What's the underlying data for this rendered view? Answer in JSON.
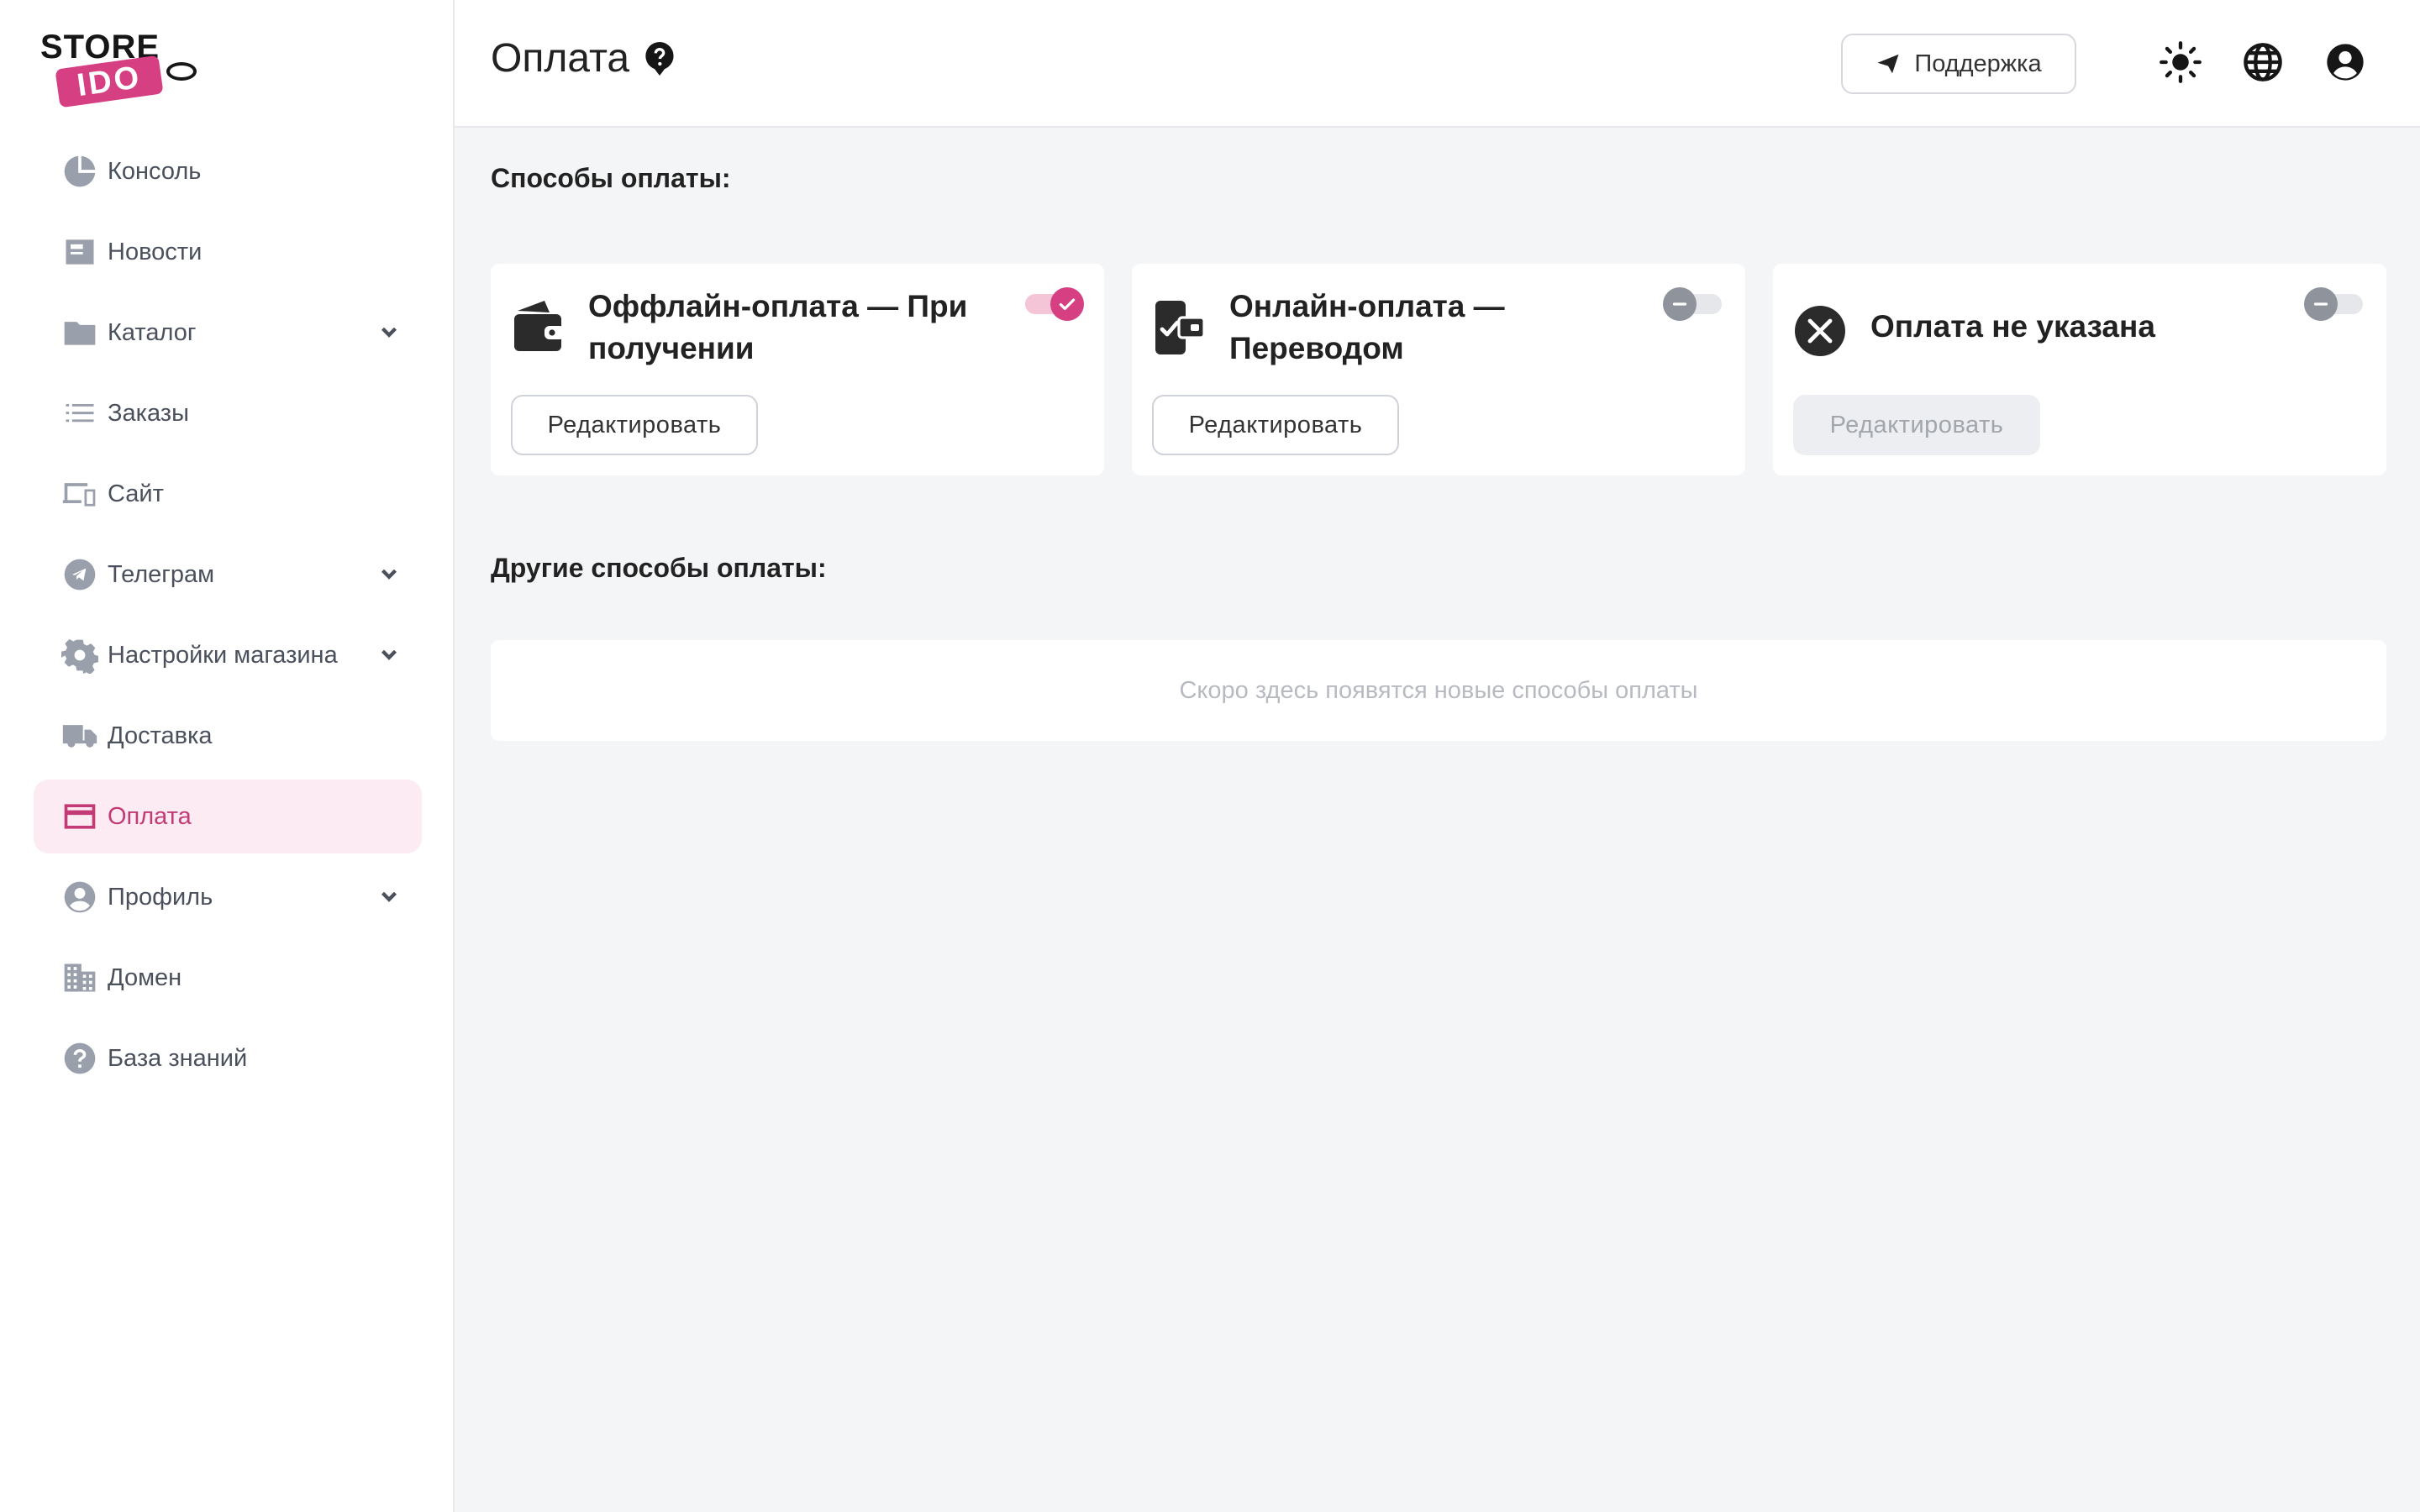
{
  "logo": {
    "line1": "STORE",
    "line2": "IDO"
  },
  "sidebar": {
    "items": [
      {
        "label": "Консоль",
        "icon": "pie-chart-icon",
        "active": false,
        "expandable": false
      },
      {
        "label": "Новости",
        "icon": "newspaper-icon",
        "active": false,
        "expandable": false
      },
      {
        "label": "Каталог",
        "icon": "folder-icon",
        "active": false,
        "expandable": true
      },
      {
        "label": "Заказы",
        "icon": "list-icon",
        "active": false,
        "expandable": false
      },
      {
        "label": "Сайт",
        "icon": "devices-icon",
        "active": false,
        "expandable": false
      },
      {
        "label": "Телеграм",
        "icon": "telegram-icon",
        "active": false,
        "expandable": true
      },
      {
        "label": "Настройки магазина",
        "icon": "gear-icon",
        "active": false,
        "expandable": true
      },
      {
        "label": "Доставка",
        "icon": "truck-icon",
        "active": false,
        "expandable": false
      },
      {
        "label": "Оплата",
        "icon": "credit-card-icon",
        "active": true,
        "expandable": false
      },
      {
        "label": "Профиль",
        "icon": "user-circle-icon",
        "active": false,
        "expandable": true
      },
      {
        "label": "Домен",
        "icon": "building-icon",
        "active": false,
        "expandable": false
      },
      {
        "label": "База знаний",
        "icon": "question-circle-icon",
        "active": false,
        "expandable": false
      }
    ]
  },
  "header": {
    "title": "Оплата",
    "support_label": "Поддержка",
    "icons": [
      "help-icon",
      "sun-icon",
      "globe-icon",
      "account-icon"
    ]
  },
  "main": {
    "methods_title": "Способы оплаты:",
    "cards": [
      {
        "title": "Оффлайн-оплата — При получении",
        "icon": "wallet-icon",
        "enabled": true,
        "edit_label": "Редактировать",
        "edit_disabled": false
      },
      {
        "title": "Онлайн-оплата — Переводом",
        "icon": "phone-wallet-icon",
        "enabled": false,
        "edit_label": "Редактировать",
        "edit_disabled": false
      },
      {
        "title": "Оплата не указана",
        "icon": "x-circle-icon",
        "enabled": false,
        "edit_label": "Редактировать",
        "edit_disabled": true
      }
    ],
    "other_title": "Другие способы оплаты:",
    "other_empty": "Скоро здесь появятся новые способы оплаты"
  },
  "colors": {
    "accent": "#d63f82",
    "active_bg": "#fcebf2",
    "active_text": "#c33b76",
    "page_bg": "#f4f5f7"
  }
}
